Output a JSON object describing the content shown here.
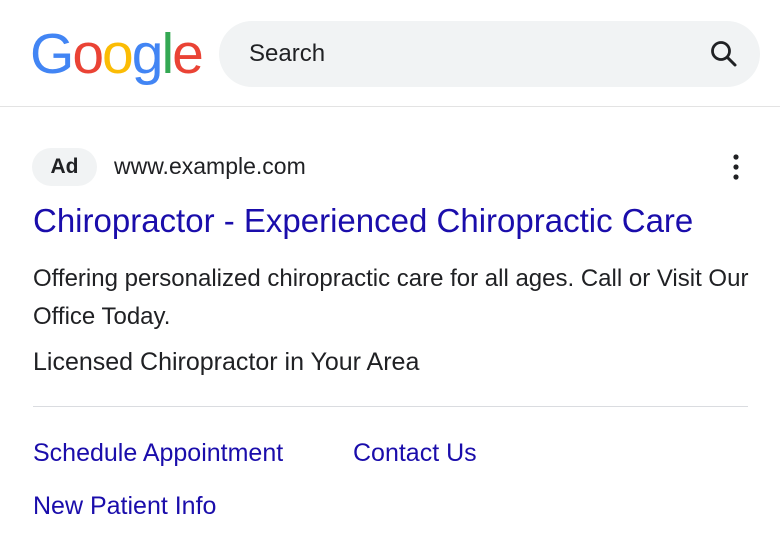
{
  "header": {
    "logo": {
      "letters": [
        "G",
        "o",
        "o",
        "g",
        "l",
        "e"
      ],
      "colors": [
        "#4285F4",
        "#EA4335",
        "#FBBC05",
        "#4285F4",
        "#34A853",
        "#EA4335"
      ]
    },
    "search": {
      "placeholder": "Search",
      "icon": "search-icon"
    }
  },
  "ad": {
    "badge": "Ad",
    "display_url": "www.example.com",
    "menu_icon": "more-vert-icon",
    "title": "Chiropractor - Experienced Chiropractic Care",
    "description": "Offering personalized chiropractic care for all ages. Call or Visit Our Office Today.",
    "tagline": "Licensed Chiropractor in Your Area",
    "sitelinks": [
      {
        "label": "Schedule Appointment"
      },
      {
        "label": "Contact Us"
      },
      {
        "label": "New Patient Info"
      }
    ]
  },
  "colors": {
    "link": "#1a0dab",
    "text": "#202124",
    "search_bg": "#f1f3f4",
    "badge_bg": "#f1f3f4",
    "divider": "#dadce0"
  }
}
